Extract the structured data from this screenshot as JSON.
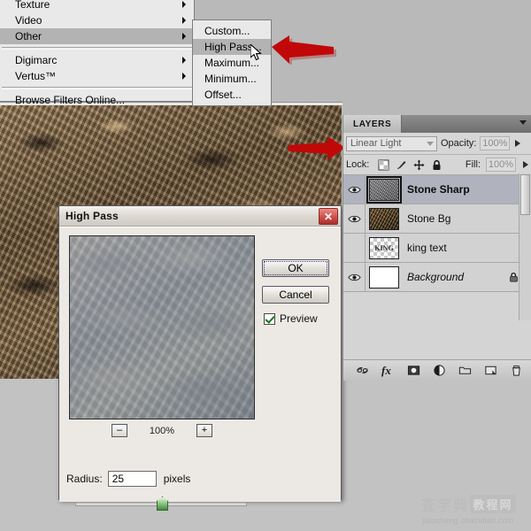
{
  "menu": {
    "items": [
      {
        "label": "Texture",
        "has_submenu": true,
        "selected": false
      },
      {
        "label": "Video",
        "has_submenu": true,
        "selected": false
      },
      {
        "label": "Other",
        "has_submenu": true,
        "selected": true
      },
      {
        "label": "Digimarc",
        "has_submenu": true,
        "selected": false
      },
      {
        "label": "Vertus™",
        "has_submenu": true,
        "selected": false
      },
      {
        "label": "Browse Filters Online...",
        "has_submenu": false,
        "selected": false
      }
    ],
    "submenu": {
      "items": [
        {
          "label": "Custom...",
          "selected": false
        },
        {
          "label": "High Pass...",
          "selected": true
        },
        {
          "label": "Maximum...",
          "selected": false
        },
        {
          "label": "Minimum...",
          "selected": false
        },
        {
          "label": "Offset...",
          "selected": false
        }
      ]
    }
  },
  "dialog": {
    "title": "High Pass",
    "close_glyph": "✕",
    "zoom": {
      "minus": "–",
      "level": "100%",
      "plus": "+"
    },
    "radius": {
      "label": "Radius:",
      "value": "25",
      "units": "pixels"
    },
    "buttons": {
      "ok": "OK",
      "cancel": "Cancel"
    },
    "preview": {
      "label": "Preview",
      "checked": true
    }
  },
  "layers_panel": {
    "tab_label": "LAYERS",
    "blend_mode": "Linear Light",
    "opacity_label": "Opacity:",
    "opacity_value": "100%",
    "lock_label": "Lock:",
    "fill_label": "Fill:",
    "fill_value": "100%",
    "lock_icons": [
      "lock-transparent-pixels-icon",
      "lock-image-pixels-icon",
      "lock-position-icon",
      "lock-all-icon"
    ],
    "layers": [
      {
        "name": "Stone Sharp",
        "visible": true,
        "selected": true,
        "thumb": "sharp",
        "bold": true,
        "italic": false,
        "locked": false
      },
      {
        "name": "Stone Bg",
        "visible": true,
        "selected": false,
        "thumb": "bg",
        "bold": false,
        "italic": false,
        "locked": false
      },
      {
        "name": "king text",
        "visible": false,
        "selected": false,
        "thumb": "checker",
        "bold": false,
        "italic": false,
        "locked": false
      },
      {
        "name": "Background",
        "visible": true,
        "selected": false,
        "thumb": "white",
        "bold": false,
        "italic": true,
        "locked": true
      }
    ],
    "footer_icons": [
      "link-layers-icon",
      "layer-style-fx-icon",
      "layer-mask-icon",
      "adjustment-layer-icon",
      "new-group-icon",
      "new-layer-icon",
      "delete-layer-icon"
    ],
    "fx_label": "fx"
  },
  "annotations": {
    "arrow_color": "#c00000",
    "arrows": [
      {
        "name": "arrow-to-high-pass-menu-item"
      },
      {
        "name": "arrow-to-canvas-layer"
      },
      {
        "name": "arrow-to-stone-sharp-layer"
      },
      {
        "name": "arrow-to-radius-field"
      }
    ]
  },
  "watermark": {
    "cn_left": "查字典",
    "cn_boxed": "教程网",
    "url": "jiaocheng.chazidian.com"
  }
}
